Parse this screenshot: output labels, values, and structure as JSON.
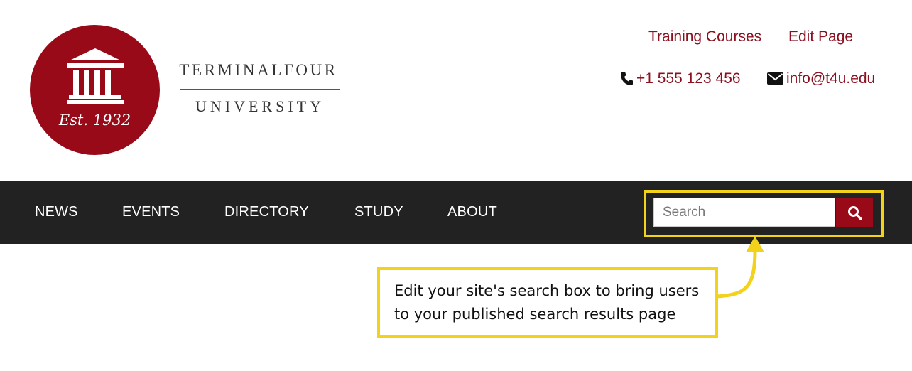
{
  "logo": {
    "est_text": "Est. 1932",
    "wordmark_top": "TERMINALFOUR",
    "wordmark_bottom": "UNIVERSITY",
    "brand_color": "#990a18"
  },
  "top_links": [
    {
      "label": "Training Courses"
    },
    {
      "label": "Edit Page"
    }
  ],
  "contact": {
    "phone_icon": "phone-icon",
    "phone": "+1 555 123 456",
    "email_icon": "envelope-icon",
    "email": "info@t4u.edu"
  },
  "nav": {
    "items": [
      {
        "label": "NEWS"
      },
      {
        "label": "EVENTS"
      },
      {
        "label": "DIRECTORY"
      },
      {
        "label": "STUDY"
      },
      {
        "label": "ABOUT"
      }
    ],
    "background": "#222222"
  },
  "search": {
    "placeholder": "Search",
    "value": "",
    "button_icon": "search-icon"
  },
  "annotation": {
    "text": "Edit your site's search box to bring users to your published search results page",
    "highlight_color": "#f2d21b"
  }
}
